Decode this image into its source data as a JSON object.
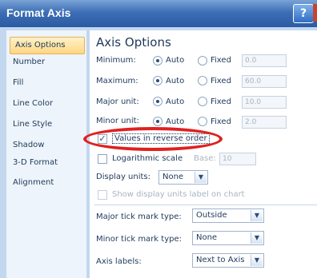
{
  "window": {
    "title": "Format Axis",
    "help": "?"
  },
  "sidebar": {
    "items": [
      {
        "label": "Axis Options"
      },
      {
        "label": "Number"
      },
      {
        "label": "Fill"
      },
      {
        "label": "Line Color"
      },
      {
        "label": "Line Style"
      },
      {
        "label": "Shadow"
      },
      {
        "label": "3-D Format"
      },
      {
        "label": "Alignment"
      }
    ]
  },
  "panel": {
    "heading": "Axis Options",
    "rows": [
      {
        "label": "Minimum:",
        "auto": "Auto",
        "fixed": "Fixed",
        "value": "0.0"
      },
      {
        "label": "Maximum:",
        "auto": "Auto",
        "fixed": "Fixed",
        "value": "60.0"
      },
      {
        "label": "Major unit:",
        "auto": "Auto",
        "fixed": "Fixed",
        "value": "10.0"
      },
      {
        "label": "Minor unit:",
        "auto": "Auto",
        "fixed": "Fixed",
        "value": "2.0"
      }
    ],
    "reverse_order": {
      "label": "Values in reverse order",
      "checked": true
    },
    "log_scale": {
      "label": "Logarithmic scale",
      "base_label": "Base:",
      "base_value": "10",
      "checked": false
    },
    "display_units": {
      "label": "Display units:",
      "value": "None"
    },
    "show_units_label": {
      "label": "Show display units label on chart",
      "checked": false
    },
    "major_tick": {
      "label": "Major tick mark type:",
      "value": "Outside"
    },
    "minor_tick": {
      "label": "Minor tick mark type:",
      "value": "None"
    },
    "axis_labels": {
      "label": "Axis labels:",
      "value": "Next to Axis"
    }
  },
  "colors": {
    "highlight": "#e02020",
    "title_bar": "#2a5aa3",
    "selected_nav": "#ffd683"
  }
}
